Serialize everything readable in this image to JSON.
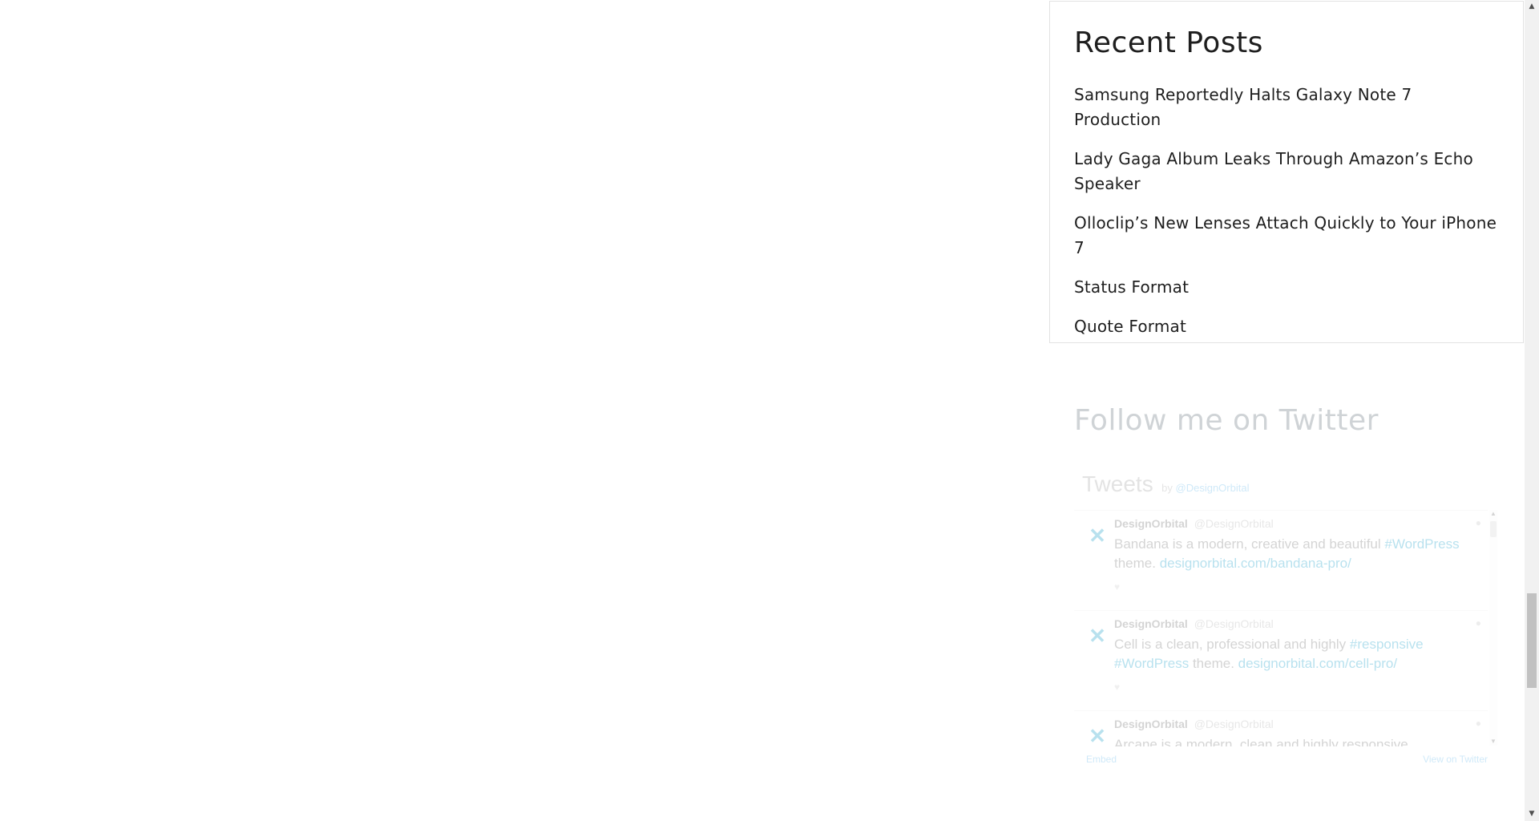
{
  "recent_posts": {
    "title": "Recent Posts",
    "items": [
      "Samsung Reportedly Halts Galaxy Note 7 Production",
      "Lady Gaga Album Leaks Through Amazon’s Echo Speaker",
      "Olloclip’s New Lenses Attach Quickly to Your iPhone 7",
      "Status Format",
      "Quote Format"
    ]
  },
  "twitter": {
    "title": "Follow me on Twitter",
    "widget_title": "Tweets",
    "by_label": "by",
    "handle": "@DesignOrbital",
    "tweets": [
      {
        "name": "DesignOrbital",
        "handle": "@DesignOrbital",
        "text_1": "Bandana is a modern, creative and beautiful ",
        "hashtag": "#WordPress",
        "text_2": " theme. ",
        "link": "designorbital.com/bandana-pro/"
      },
      {
        "name": "DesignOrbital",
        "handle": "@DesignOrbital",
        "text_1": "Cell is a clean, professional and highly ",
        "hashtag": "#responsive #WordPress",
        "text_2": " theme. ",
        "link": "designorbital.com/cell-pro/"
      },
      {
        "name": "DesignOrbital",
        "handle": "@DesignOrbital",
        "text_1": "Arcane is a modern, clean and highly responsive",
        "hashtag": "",
        "text_2": "",
        "link": ""
      }
    ],
    "footer_embed": "Embed",
    "footer_view": "View on Twitter"
  },
  "icons": {
    "avatar": "designorbital-logo-icon",
    "scroll_up": "arrow-up-icon",
    "scroll_down": "arrow-down-icon"
  }
}
